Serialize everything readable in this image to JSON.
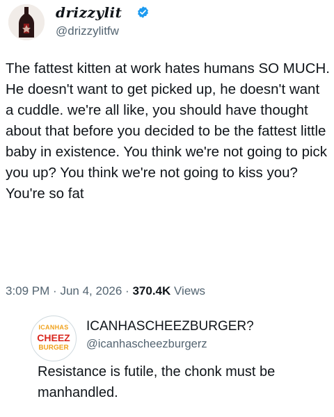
{
  "tweet": {
    "display_name": "drizzylit",
    "handle": "@drizzylitfw",
    "verified": true,
    "text": "The fattest kitten at work hates humans SO MUCH. He doesn't want to get picked up, he doesn't want a cuddle. we're all like, you should have thought about that before you decided to be the fattest little baby in existence. You think we're not going to pick you up? You think we're not going to kiss you?\nYou're so fat",
    "time": "3:09 PM",
    "separator": "·",
    "date": "Jun 4, 2026",
    "views_count": "370.4K",
    "views_label": "Views"
  },
  "quote": {
    "display_name": "ICANHASCHEEZBURGER?",
    "handle": "@icanhascheezburgerz",
    "avatar_logo": [
      "ICANHAS",
      "CHEEZ",
      "BURGER"
    ],
    "text": "Resistance is futile, the chonk must be manhandled."
  },
  "colors": {
    "text": "#0f1419",
    "secondary": "#536471",
    "verified": "#1d9bf0",
    "logo_orange": "#f0a21e",
    "logo_red": "#d9251d"
  },
  "icons": {
    "verified": "verified-badge-icon",
    "avatar": "bottle-avatar"
  }
}
